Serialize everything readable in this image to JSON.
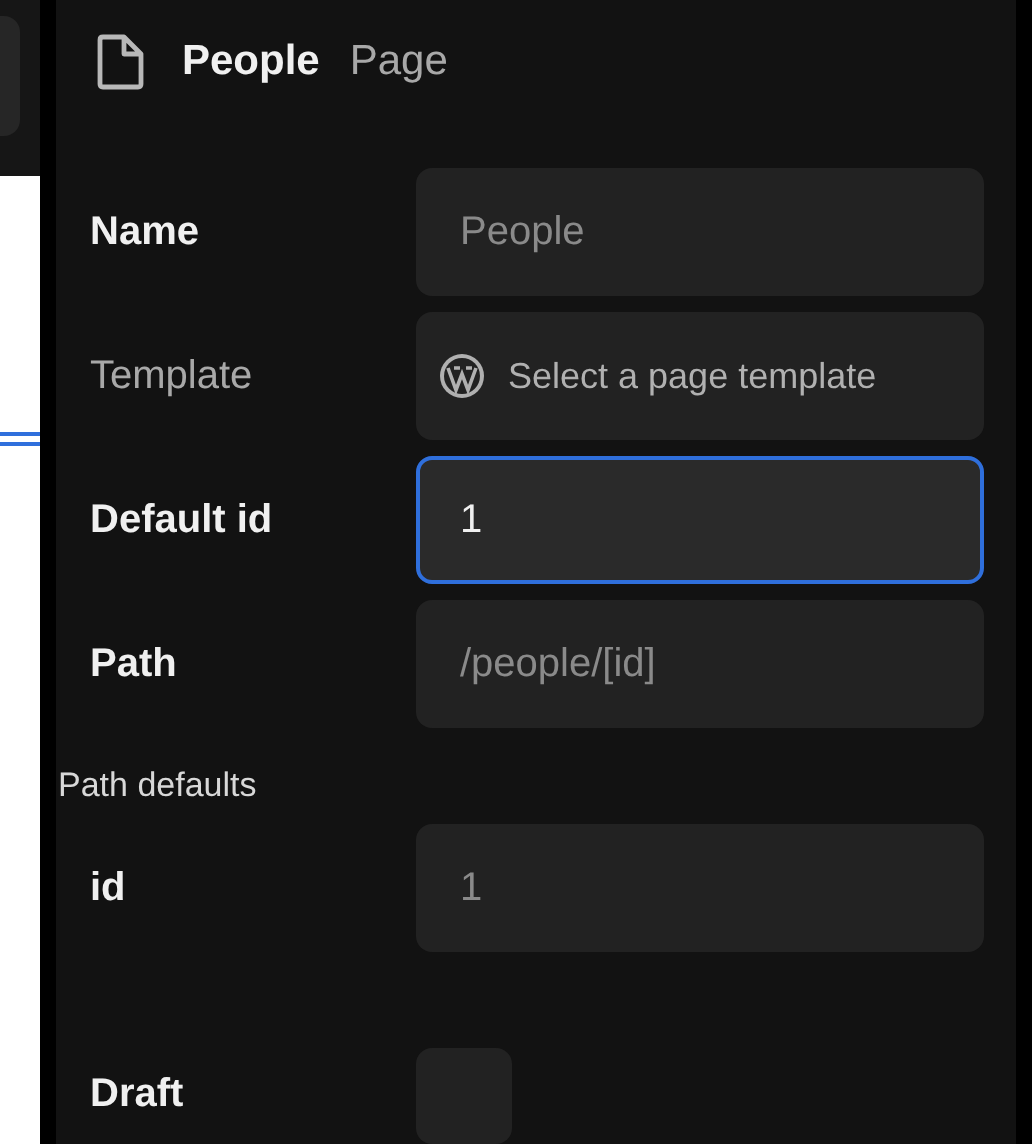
{
  "header": {
    "title": "People",
    "type": "Page"
  },
  "fields": [
    {
      "label": "Name",
      "kind": "text",
      "strong": true,
      "placeholder": "People"
    },
    {
      "label": "Template",
      "kind": "select",
      "strong": false,
      "placeholder": "Select a page template"
    },
    {
      "label": "Default id",
      "kind": "text",
      "strong": true,
      "value": "1",
      "focused": true
    },
    {
      "label": "Path",
      "kind": "text",
      "strong": true,
      "placeholder": "/people/[id]"
    }
  ],
  "path_defaults": {
    "title": "Path defaults",
    "fields": [
      {
        "label": "id",
        "kind": "text",
        "strong": true,
        "placeholder": "1"
      }
    ]
  },
  "draft": {
    "label": "Draft",
    "checked": false
  }
}
